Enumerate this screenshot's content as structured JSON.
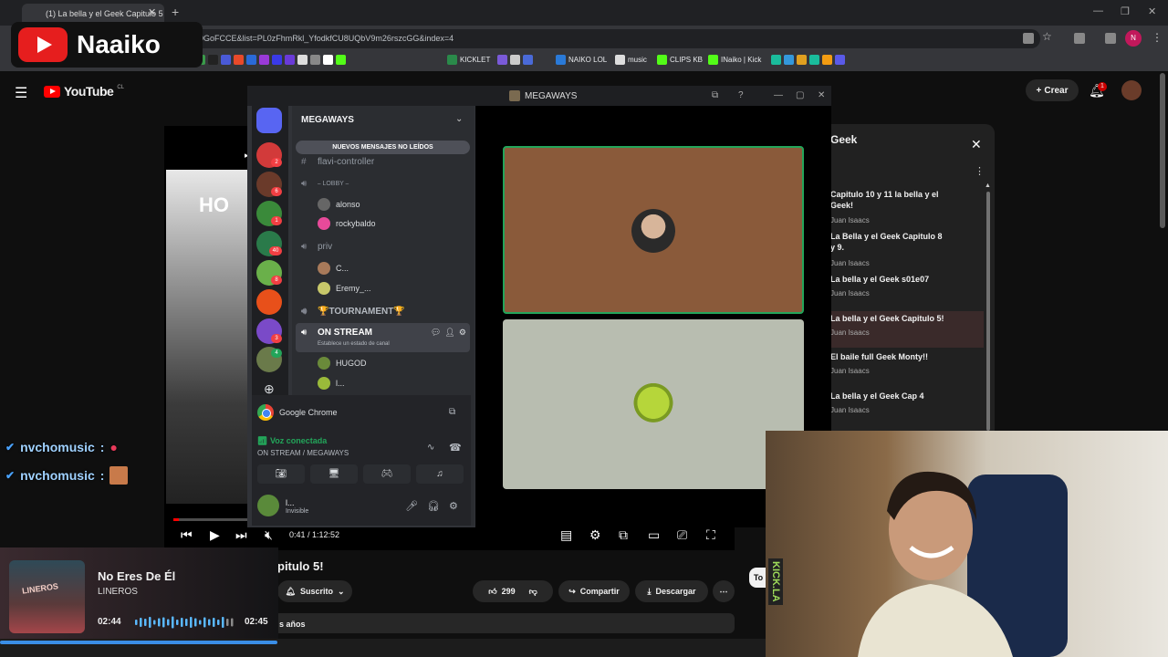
{
  "browser": {
    "tab_title": "(1) La bella y el Geek Capitulo 5",
    "url": "0GoFCCE&list=PL0zFhmRkl_YfodkfCU8UQbV9m26rszcGG&index=4",
    "bookmarks": [
      "KICKLET",
      "NAIKO LOL",
      "music",
      "CLIPS KB",
      "INaiko | Kick"
    ],
    "profile_initial": "N"
  },
  "overlay": {
    "logo_text": "Naaiko"
  },
  "youtube": {
    "logo_text": "YouTube",
    "country": "CL",
    "create_label": "Crear",
    "notif_count": "1",
    "video_overlay_text": "HO",
    "time": "0:41 / 1:12:52",
    "progress": 0.0094,
    "video_title": "pitulo 5!",
    "subscribed_label": "Suscrito",
    "likes": "299",
    "share_label": "Compartir",
    "download_label": "Descargar",
    "ago": "s años",
    "partial_tab": "To"
  },
  "playlist": {
    "title": "Geek",
    "items": [
      {
        "title": "Capitulo 10 y 11 la bella y el Geek!",
        "channel": "Juan Isaacs"
      },
      {
        "title": "La Bella y el Geek Capitulo 8 y 9.",
        "channel": "Juan Isaacs"
      },
      {
        "title": "La bella y el Geek s01e07",
        "channel": "Juan Isaacs"
      },
      {
        "title": "La bella y el Geek Capitulo 5!",
        "channel": "Juan Isaacs"
      },
      {
        "title": "El baile full Geek Monty!!",
        "channel": "Juan Isaacs"
      },
      {
        "title": "La bella y el Geek Cap 4",
        "channel": "Juan Isaacs"
      }
    ]
  },
  "discord": {
    "window_title": "MEGAWAYS",
    "server_name": "MEGAWAYS",
    "new_messages": "NUEVOS MENSAJES NO LEÍDOS",
    "guild_badges": [
      "2",
      "6",
      "1",
      "40",
      "8",
      "3",
      "4"
    ],
    "channels": {
      "flavi": "flavi-controller",
      "lobby": "⎯ LOBBY ⎯",
      "lobby_members": [
        "alonso",
        "rockybaldo"
      ],
      "priv": "priv",
      "priv_members": [
        "C...",
        "Eremy_..."
      ],
      "tournament": "🏆TOURNAMENT🏆",
      "onstream": "ON STREAM",
      "onstream_sub": "Establece un estado de canal",
      "onstream_members": [
        "HUGOD",
        "l..."
      ]
    },
    "stream_app": "Google Chrome",
    "voice_status": "Voz conectada",
    "voice_channel": "ON STREAM / MEGAWAYS",
    "user_name": "l...",
    "user_status": "Invisible"
  },
  "chat": [
    {
      "user": "nvchomusic",
      "sep": ":"
    },
    {
      "user": "nvchomusic",
      "sep": ":"
    }
  ],
  "music": {
    "song": "No Eres De Él",
    "artist": "LINEROS",
    "time_start": "02:44",
    "time_end": "02:45",
    "album_text": "LINEROS"
  },
  "webcam": {
    "sign": "KICK.LA"
  }
}
